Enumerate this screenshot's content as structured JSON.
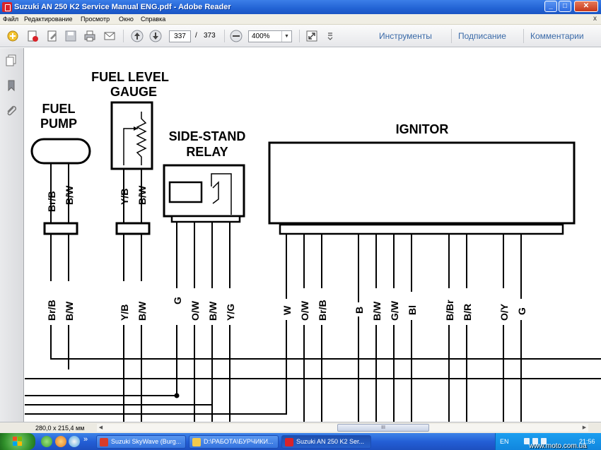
{
  "window": {
    "title": "Suzuki AN 250 K2 Service Manual ENG.pdf - Adobe Reader",
    "controls": {
      "minimize": "_",
      "maximize": "□",
      "close": "✕"
    }
  },
  "menu": {
    "items": [
      "Файл",
      "Редактирование",
      "Просмотр",
      "Окно",
      "Справка"
    ],
    "close_glyph": "x"
  },
  "toolbar": {
    "current_page": "337",
    "page_separator": "/",
    "total_pages": "373",
    "zoom": "400%",
    "zoom_dropdown_glyph": "▼",
    "links": [
      "Инструменты",
      "Подписание",
      "Комментарии"
    ]
  },
  "diagram": {
    "components": {
      "fuel_pump": [
        "FUEL",
        "PUMP"
      ],
      "fuel_level_gauge": [
        "FUEL LEVEL",
        "GAUGE"
      ],
      "side_stand_relay": [
        "SIDE-STAND",
        "RELAY"
      ],
      "ignitor": "IGNITOR"
    },
    "upper_wire_labels": {
      "fuel_pump": [
        "Br/B",
        "B/W"
      ],
      "fuel_level_gauge": [
        "Y/B",
        "B/W"
      ]
    },
    "lower_wire_labels": [
      "Br/B",
      "B/W",
      "Y/B",
      "B/W",
      "G",
      "O/W",
      "B/W",
      "Y/G",
      "W",
      "O/W",
      "Br/B",
      "B",
      "B/W",
      "G/W",
      "Bl",
      "B/Br",
      "B/R",
      "O/Y",
      "G"
    ]
  },
  "statusbar": {
    "page_size": "280,0 x 215,4 мм",
    "scroll_thumb_grip": "III",
    "scroll_left": "◀",
    "scroll_right": "▶"
  },
  "taskbar": {
    "more_glyph": "»",
    "tasks": [
      {
        "label": "Suzuki SkyWave (Burg...",
        "active": false,
        "icon_color": "#d83b2a"
      },
      {
        "label": "D:\\РАБОТА\\БУРЧИКИ...",
        "active": false,
        "icon_color": "#f2c94c"
      },
      {
        "label": "Suzuki AN 250 K2 Ser...",
        "active": true,
        "icon_color": "#d8232a"
      }
    ],
    "tray": {
      "language": "EN",
      "clock": "21:56"
    },
    "watermark": "www.moto.com.ua"
  }
}
